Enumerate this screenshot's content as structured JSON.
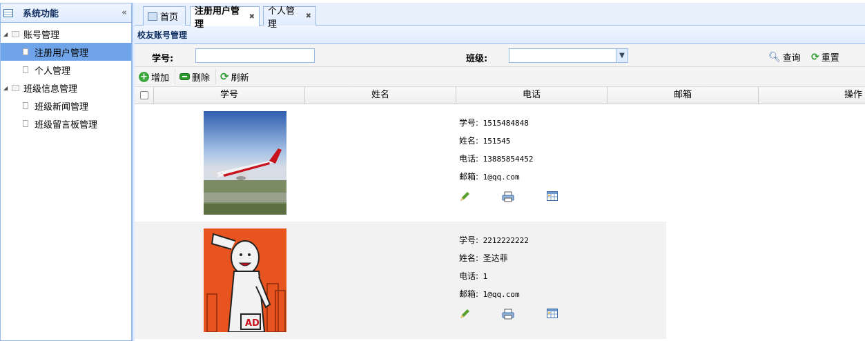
{
  "sidebar": {
    "title": "系统功能",
    "collapse_glyph": "«",
    "tree": [
      {
        "label": "账号管理",
        "children": [
          "注册用户管理",
          "个人管理"
        ]
      },
      {
        "label": "班级信息管理",
        "children": [
          "班级新闻管理",
          "班级留言板管理"
        ]
      }
    ]
  },
  "tabs": [
    {
      "label": "首页",
      "icon": "home-icon",
      "closable": false
    },
    {
      "label": "注册用户管理",
      "closable": true,
      "active": true
    },
    {
      "label": "个人管理",
      "closable": true
    }
  ],
  "panel": {
    "title": "校友账号管理"
  },
  "search": {
    "student_id_label": "学号:",
    "student_id_value": "",
    "class_label": "班级:",
    "class_value": "",
    "query_label": "查询",
    "reset_label": "重置"
  },
  "toolbar": {
    "add": "增加",
    "delete": "删除",
    "refresh": "刷新"
  },
  "grid": {
    "columns": [
      "学号",
      "姓名",
      "电话",
      "邮箱",
      "操作"
    ]
  },
  "records": [
    {
      "photo": "airplane-photo",
      "id_label": "学号:",
      "id": "1515484848",
      "name_label": "姓名:",
      "name": "151545",
      "phone_label": "电话:",
      "phone": "13885854452",
      "email_label": "邮箱:",
      "email": "1@qq.com"
    },
    {
      "photo": "cartoon-figure-photo",
      "id_label": "学号:",
      "id": "2212222222",
      "name_label": "姓名:",
      "name": "圣达菲",
      "phone_label": "电话:",
      "phone": "1",
      "email_label": "邮箱:",
      "email": "1@qq.com"
    }
  ],
  "colors": {
    "border": "#95b8e7",
    "header_bg": "#e0ecff",
    "selected": "#6fa4e8"
  }
}
